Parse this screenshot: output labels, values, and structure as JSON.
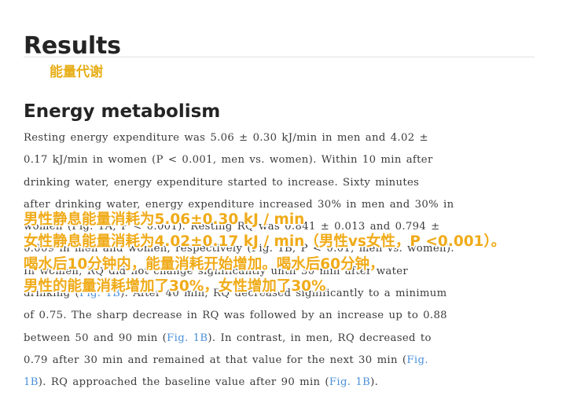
{
  "section": {
    "title": "Results"
  },
  "subsection": {
    "annotation": "能量代谢",
    "title": "Energy metabolism"
  },
  "paragraph": {
    "lines": [
      "Resting energy expenditure was 5.06 ± 0.30 kJ/min in men and 4.02 ±",
      "0.17 kJ/min in women (P < 0.001, men vs. women). Within 10 min after",
      "drinking water, energy expenditure started to increase. Sixty minutes",
      "after drinking water, energy expenditure increased 30% in men and 30% in",
      "women (Fig. 1A, P < 0.001). Resting RQ was 0.841 ± 0.013 and 0.794 ±",
      "0.009 in men and women, respectively (Fig. 1B, P < 0.01, men vs. women).",
      "In women, RQ did not change significantly until 30 min after water",
      "drinking (Fig. 1B). After 40 min, RQ decreased significantly to a minimum",
      "of 0.75. The sharp decrease in RQ was followed by an increase up to 0.88",
      "between 50 and 90 min (Fig. 1B). In contrast, in men, RQ decreased to",
      "0.79 after 30 min and remained at that value for the next 30 min (Fig.",
      "1B). RQ approached the baseline value after 90 min (Fig. 1B)."
    ],
    "full_text": "Resting energy expenditure was 5.06 ± 0.30 kJ/min in men and 4.02 ± 0.17 kJ/min in women (P < 0.001, men vs. women). Within 10 min after drinking water, energy expenditure started to increase. Sixty minutes after drinking water, energy expenditure increased 30% in men and 30% in women (Fig. 1A, P < 0.001). Resting RQ was 0.841 ± 0.013 and 0.794 ± 0.009 in men and women, respectively (Fig. 1B, P < 0.01, men vs. women). In women, RQ did not change significantly until 30 min after water drinking (Fig. 1B). After 40 min, RQ decreased significantly to a minimum of 0.75. The sharp decrease in RQ was followed by an increase up to 0.88 between 50 and 90 min (Fig. 1B). In contrast, in men, RQ decreased to 0.79 after 30 min and remained at that value for the next 30 min (Fig. 1B). RQ approached the baseline value after 90 min (Fig. 1B).",
    "link_label": "Fig. 1B",
    "link_label_a": "Fig. 1A"
  },
  "overlay_translation": {
    "lines": [
      "男性静息能量消耗为5.06±0.30 kJ / min",
      "女性静息能量消耗为4.02±0.17 kJ / min（男性vs女性，P <0.001）。",
      "喝水后10分钟内，能量消耗开始增加。喝水后60分钟，",
      "男性的能量消耗增加了30%，女性增加了30%"
    ]
  },
  "colors": {
    "overlay_text": "#f0ab19",
    "overlay_outline": "#ffffff",
    "annotation_text": "#e8ae18",
    "heading": "#242424",
    "body": "#3b3b3b",
    "link": "#4a90d9",
    "rule": "#e2e2e2",
    "background": "#ffffff"
  }
}
